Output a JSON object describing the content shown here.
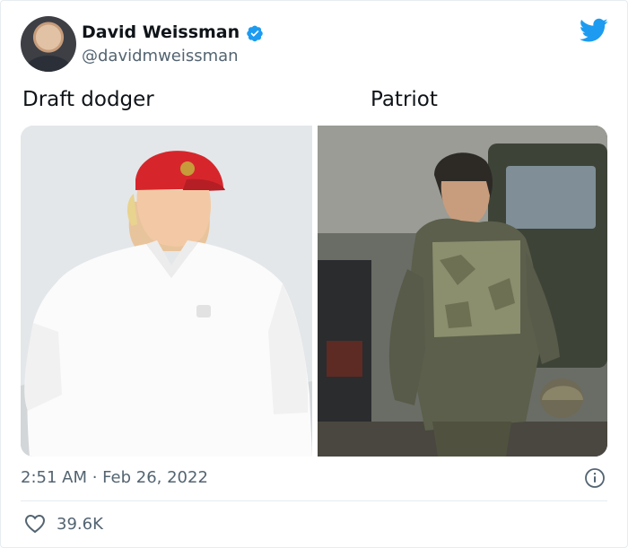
{
  "tweet": {
    "author_name": "David Weissman",
    "author_handle": "@davidmweissman",
    "image_labels": {
      "left": "Draft dodger",
      "right": "Patriot"
    },
    "timestamp": "2:51 AM · Feb 26, 2022",
    "like_count": "39.6K"
  },
  "colors": {
    "twitter_blue": "#1d9bf0",
    "secondary_text": "#536471",
    "primary_text": "#0f1419",
    "divider": "#e6ecf0"
  },
  "icons": {
    "verified": "verified-badge-icon",
    "brand": "twitter-bird-icon",
    "info": "info-icon",
    "like": "heart-icon"
  }
}
